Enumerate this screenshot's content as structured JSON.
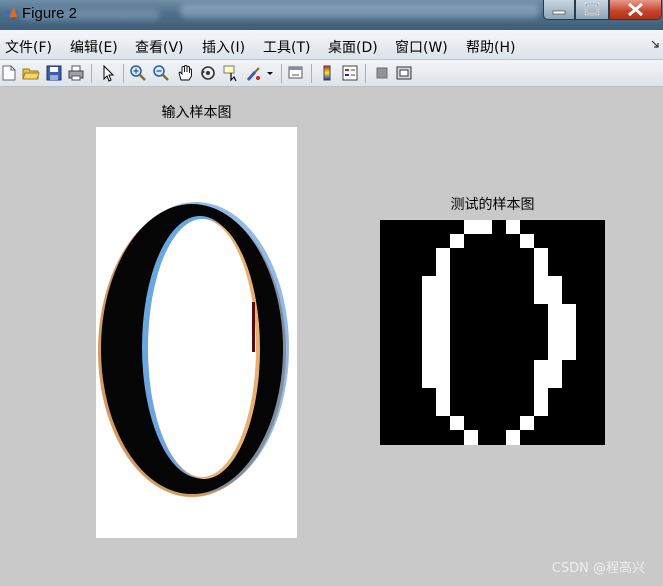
{
  "window": {
    "title": "Figure 2"
  },
  "menu": {
    "items": [
      {
        "label": "文件(F)"
      },
      {
        "label": "编辑(E)"
      },
      {
        "label": "查看(V)"
      },
      {
        "label": "插入(I)"
      },
      {
        "label": "工具(T)"
      },
      {
        "label": "桌面(D)"
      },
      {
        "label": "窗口(W)"
      },
      {
        "label": "帮助(H)"
      }
    ]
  },
  "toolbar": {
    "tools": [
      "new-figure-icon",
      "open-file-icon",
      "save-icon",
      "print-icon",
      "pointer-icon",
      "zoom-in-icon",
      "zoom-out-icon",
      "pan-hand-icon",
      "rotate-3d-icon",
      "data-cursor-icon",
      "brush-icon",
      "link-plot-icon",
      "colorbar-icon",
      "legend-icon",
      "hide-plot-tools-icon",
      "show-plot-tools-icon"
    ]
  },
  "figure": {
    "left_axes": {
      "title": "输入样本图"
    },
    "right_axes": {
      "title": "测试的样本图"
    }
  },
  "watermark": "CSDN @程高兴"
}
